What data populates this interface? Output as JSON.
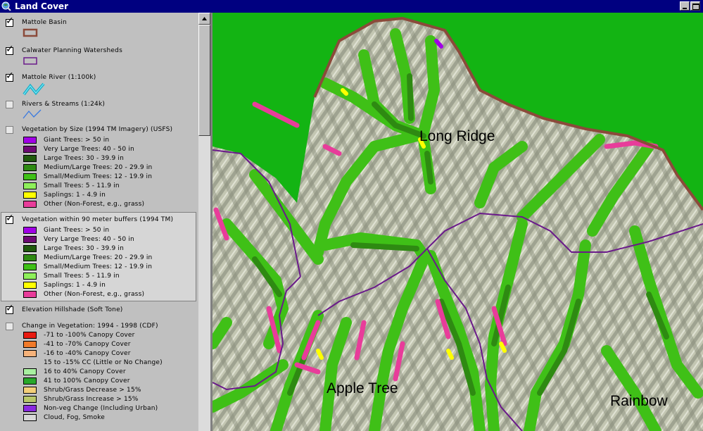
{
  "window": {
    "title": "Land Cover"
  },
  "legend": {
    "layers": [
      {
        "name": "Mattole Basin",
        "checked": true
      },
      {
        "name": "Calwater Planning Watersheds",
        "checked": true
      },
      {
        "name": "Mattole River (1:100k)",
        "checked": true
      },
      {
        "name": "Rivers & Streams (1:24k)",
        "checked": false
      },
      {
        "name": "Vegetation by Size (1994 TM Imagery) (USFS)",
        "checked": false,
        "classes": [
          {
            "label": "Giant Trees: > 50 in",
            "color": "#a100e6"
          },
          {
            "label": "Very Large Trees: 40 - 50 in",
            "color": "#6d0a73"
          },
          {
            "label": "Large Trees: 30 - 39.9 in",
            "color": "#1f5a0c"
          },
          {
            "label": "Medium/Large Trees: 20 - 29.9 in",
            "color": "#2e8a12"
          },
          {
            "label": "Small/Medium Trees: 12 - 19.9 in",
            "color": "#3fc017"
          },
          {
            "label": "Small Trees: 5 - 11.9 in",
            "color": "#8ef05a"
          },
          {
            "label": "Saplings: 1 - 4.9 in",
            "color": "#ffff00"
          },
          {
            "label": "Other (Non-Forest, e.g., grass)",
            "color": "#e83c9a"
          }
        ]
      },
      {
        "name": "Vegetation within 90 meter buffers (1994 TM)",
        "checked": true,
        "classes": [
          {
            "label": "Giant Trees: > 50 in",
            "color": "#a100e6"
          },
          {
            "label": "Very Large Trees: 40 - 50 in",
            "color": "#6d0a73"
          },
          {
            "label": "Large Trees: 30 - 39.9 in",
            "color": "#1f5a0c"
          },
          {
            "label": "Medium/Large Trees: 20 - 29.9 in",
            "color": "#2e8a12"
          },
          {
            "label": "Small/Medium Trees: 12 - 19.9 in",
            "color": "#3fc017"
          },
          {
            "label": "Small Trees: 5 - 11.9 in",
            "color": "#8ef05a"
          },
          {
            "label": "Saplings: 1 - 4.9 in",
            "color": "#ffff00"
          },
          {
            "label": "Other (Non-Forest, e.g., grass)",
            "color": "#e83c9a"
          }
        ]
      },
      {
        "name": "Elevation Hillshade (Soft Tone)",
        "checked": true
      },
      {
        "name": "Change in Vegetation: 1994 - 1998 (CDF)",
        "checked": false,
        "classes": [
          {
            "label": "-71 to -100% Canopy Cover",
            "color": "#e81a10"
          },
          {
            "label": "-41 to -70% Canopy Cover",
            "color": "#f07a2a"
          },
          {
            "label": "-16 to -40% Canopy Cover",
            "color": "#f5b27a"
          },
          {
            "label": "15 to -15% CC (Little or No Change)",
            "color": ""
          },
          {
            "label": "16 to 40% Canopy Cover",
            "color": "#a8f0a0"
          },
          {
            "label": "41 to 100% Canopy Cover",
            "color": "#28a82a"
          },
          {
            "label": "Shrub/Grass Decrease > 15%",
            "color": "#f3cf7a"
          },
          {
            "label": "Shrub/Grass Increase > 15%",
            "color": "#b8c86a"
          },
          {
            "label": "Non-veg Change (Including Urban)",
            "color": "#8a2ae0"
          },
          {
            "label": "Cloud, Fog, Smoke",
            "color": "#d8d8d8"
          }
        ]
      }
    ]
  },
  "map": {
    "labels": {
      "long_ridge": "Long Ridge",
      "apple_tree": "Apple Tree",
      "rainbow": "Rainbow"
    },
    "colors": {
      "background": "#13b413",
      "basin_outline": "#8b4a3a",
      "watershed_line": "#6a1a8a",
      "hillshade": "#bfc2b0"
    }
  }
}
